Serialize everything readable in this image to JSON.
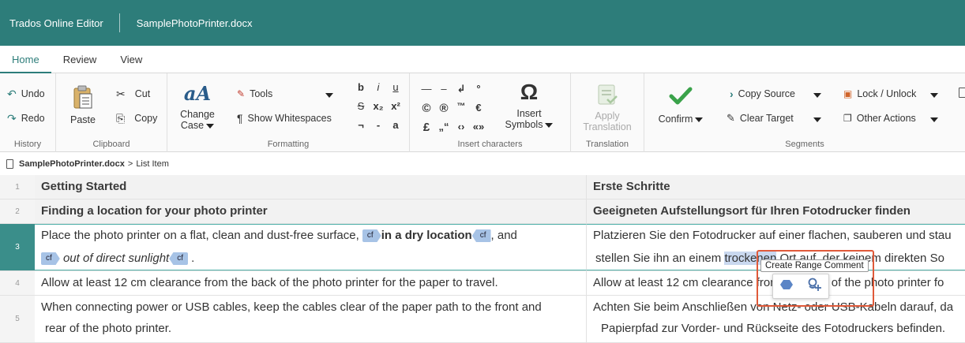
{
  "app": {
    "title": "Trados Online Editor",
    "document": "SamplePhotoPrinter.docx"
  },
  "tabs": [
    "Home",
    "Review",
    "View"
  ],
  "ribbon": {
    "history": {
      "label": "History",
      "undo": "Undo",
      "redo": "Redo"
    },
    "clipboard": {
      "label": "Clipboard",
      "paste": "Paste",
      "cut": "Cut",
      "copy": "Copy"
    },
    "formatting": {
      "label": "Formatting",
      "change_case_1": "Change",
      "change_case_2": "Case",
      "tools": "Tools",
      "show_whitespaces": "Show Whitespaces",
      "case_icon": "aA",
      "bold": "b",
      "italic": "i",
      "underline": "u",
      "strike": "S",
      "sub": "x₂",
      "sup": "x²",
      "not": "¬",
      "dash": "-",
      "smallcaps": "a"
    },
    "insert": {
      "label": "Insert characters",
      "symbols_1": "Insert",
      "symbols_2": "Symbols",
      "omega": "Ω",
      "chars": [
        "—",
        "–",
        "↲",
        "°",
        "©",
        "®",
        "™",
        "€",
        "£",
        "„“",
        "‹›",
        "«»"
      ]
    },
    "translation": {
      "label": "Translation",
      "apply_1": "Apply",
      "apply_2": "Translation"
    },
    "segments": {
      "label": "Segments",
      "confirm": "Confirm",
      "copy_source": "Copy Source",
      "clear_target": "Clear Target",
      "lock_unlock": "Lock / Unlock",
      "other_actions": "Other Actions"
    }
  },
  "breadcrumb": {
    "file": "SamplePhotoPrinter.docx",
    "sep": ">",
    "item": "List Item"
  },
  "rows": [
    {
      "num": "1",
      "source": "Getting Started",
      "target": "Erste Schritte"
    },
    {
      "num": "2",
      "source": "Finding a location for your photo printer",
      "target": "Geeigneten Aufstellungsort für Ihren Fotodrucker finden"
    },
    {
      "num": "3",
      "source_a": "Place the photo printer on a flat, clean and dust-free surface,",
      "source_b": "in a dry location",
      "source_c": ", and",
      "source_d": "out of direct sunlight",
      "source_e": ".",
      "target_a": "Platzieren Sie den Fotodrucker auf einer flachen, sauberen und stau",
      "target_b": "stellen Sie ihn an einem",
      "target_c": "trockenen",
      "target_d": "Ort auf, der keinem direkten So"
    },
    {
      "num": "4",
      "source": "Allow at least 12 cm clearance from the back of the photo printer for the paper to travel.",
      "target": "Allow at least 12 cm clearance from the back of the photo printer fo"
    },
    {
      "num": "5",
      "source_a": "When connecting power or USB cables, keep the cables clear of the paper path to the front and",
      "source_b": "rear of the photo printer.",
      "target_a": "Achten Sie beim Anschließen von Netz- oder USB-Kabeln darauf, da",
      "target_b": "Papierpfad zur Vorder- und Rückseite des Fotodruckers befinden."
    }
  ],
  "tag_label": "cf",
  "popup": {
    "tooltip": "Create Range Comment"
  },
  "colors": {
    "accent": "#2d7d7a",
    "highlight": "#e05a3a",
    "tag": "#a7c3e6"
  }
}
